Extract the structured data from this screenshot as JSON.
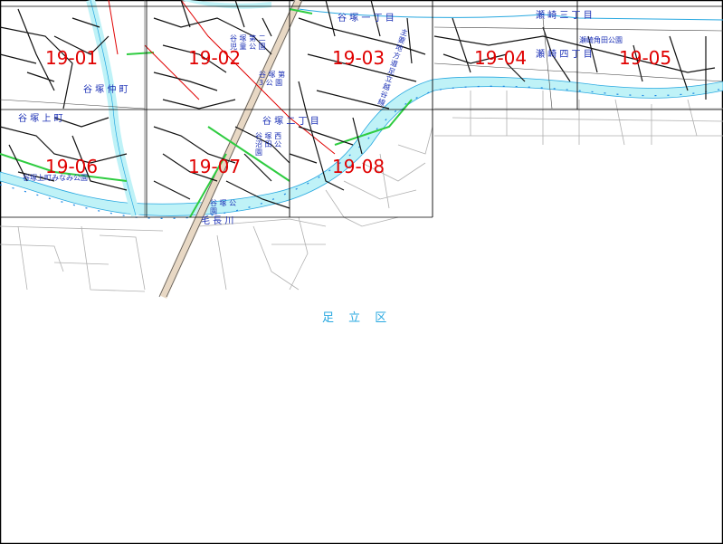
{
  "sheets": [
    {
      "id": "19-01",
      "label": "19-01"
    },
    {
      "id": "19-02",
      "label": "19-02"
    },
    {
      "id": "19-03",
      "label": "19-03"
    },
    {
      "id": "19-04",
      "label": "19-04"
    },
    {
      "id": "19-05",
      "label": "19-05"
    },
    {
      "id": "19-06",
      "label": "19-06"
    },
    {
      "id": "19-07",
      "label": "19-07"
    },
    {
      "id": "19-08",
      "label": "19-08"
    }
  ],
  "places": {
    "yatsuka_1chome": "谷 塚 一 丁 目",
    "sezaki_3chome": "瀬 崎 三 丁 目",
    "sezaki_4chome": "瀬 崎 四 丁 目",
    "sezaki_kado_park": "瀬崎角田公園",
    "yatsuka_nakamachi": "谷 塚 仲 町",
    "yatsuka_kamicho": "谷 塚 上 町",
    "yatsuka_2chome": "谷 塚 二 丁 目",
    "yatsuka_kamicho_minami_park": "谷塚上町みなみ公園",
    "yatsuka_nishi_numata_park": "谷 塚 西 沼 田 公 園",
    "yatsuka_children_park": "谷 塚 第 二 児 童 公 園",
    "yatsuka_park": "谷 塚 第 3 公 園",
    "kenage_river": "毛 長 川",
    "ward": "足 立 区",
    "road_label": "主 要 地 方 道 足 立 越 谷 線",
    "park_small": "谷 塚 公 園"
  },
  "colors": {
    "sheet_label": "#e00000",
    "river": "#bff2f7",
    "place_label": "#1a2fb5",
    "ward_label": "#28a8e0",
    "sewer_main": "#000000",
    "road": "#999999",
    "railway": "#e8d8c4"
  }
}
